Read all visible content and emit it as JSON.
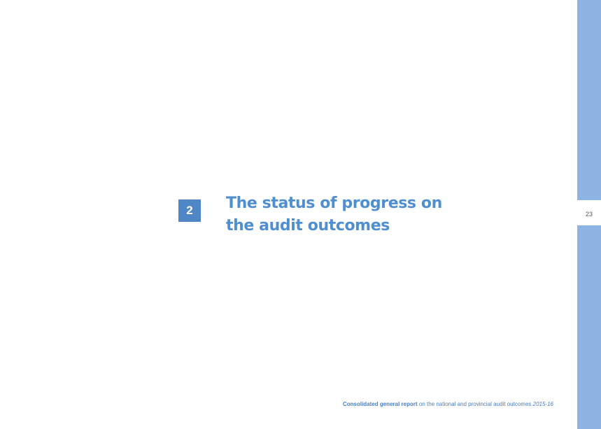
{
  "sidebar": {
    "page_number": "23",
    "bar_color": "#8db4e2"
  },
  "chapter": {
    "number": "2",
    "title_line_1": "The status of progress on",
    "title_line_2": "the audit outcomes",
    "accent_color": "#4f86c6"
  },
  "footer": {
    "bold_text": "Consolidated general report",
    "text": " on the national and provincial audit outcomes ",
    "year": "2015-16"
  }
}
